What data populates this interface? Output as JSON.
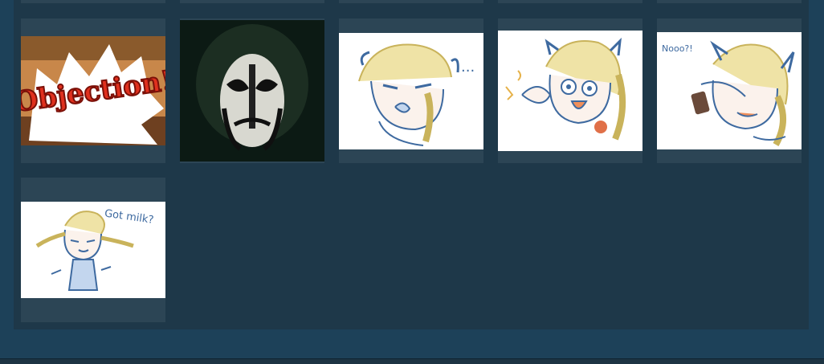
{
  "gallery": {
    "items": [
      {
        "name": "objection-sticker",
        "text": "Objection!"
      },
      {
        "name": "masked-face-sticker",
        "text": ""
      },
      {
        "name": "girl-pout-sticker",
        "text": "..."
      },
      {
        "name": "girl-shocked-sticker",
        "text": ""
      },
      {
        "name": "girl-phone-sticker",
        "text": "Nooo?!"
      },
      {
        "name": "got-milk-sticker",
        "text": "Got milk?"
      }
    ]
  },
  "colors": {
    "page_bg": "#1d4159",
    "panel_bg": "#1e3849",
    "tile_bg": "#2c4555",
    "sketch_blue": "#3e6aa0",
    "sketch_yellow": "#e6d27a"
  }
}
